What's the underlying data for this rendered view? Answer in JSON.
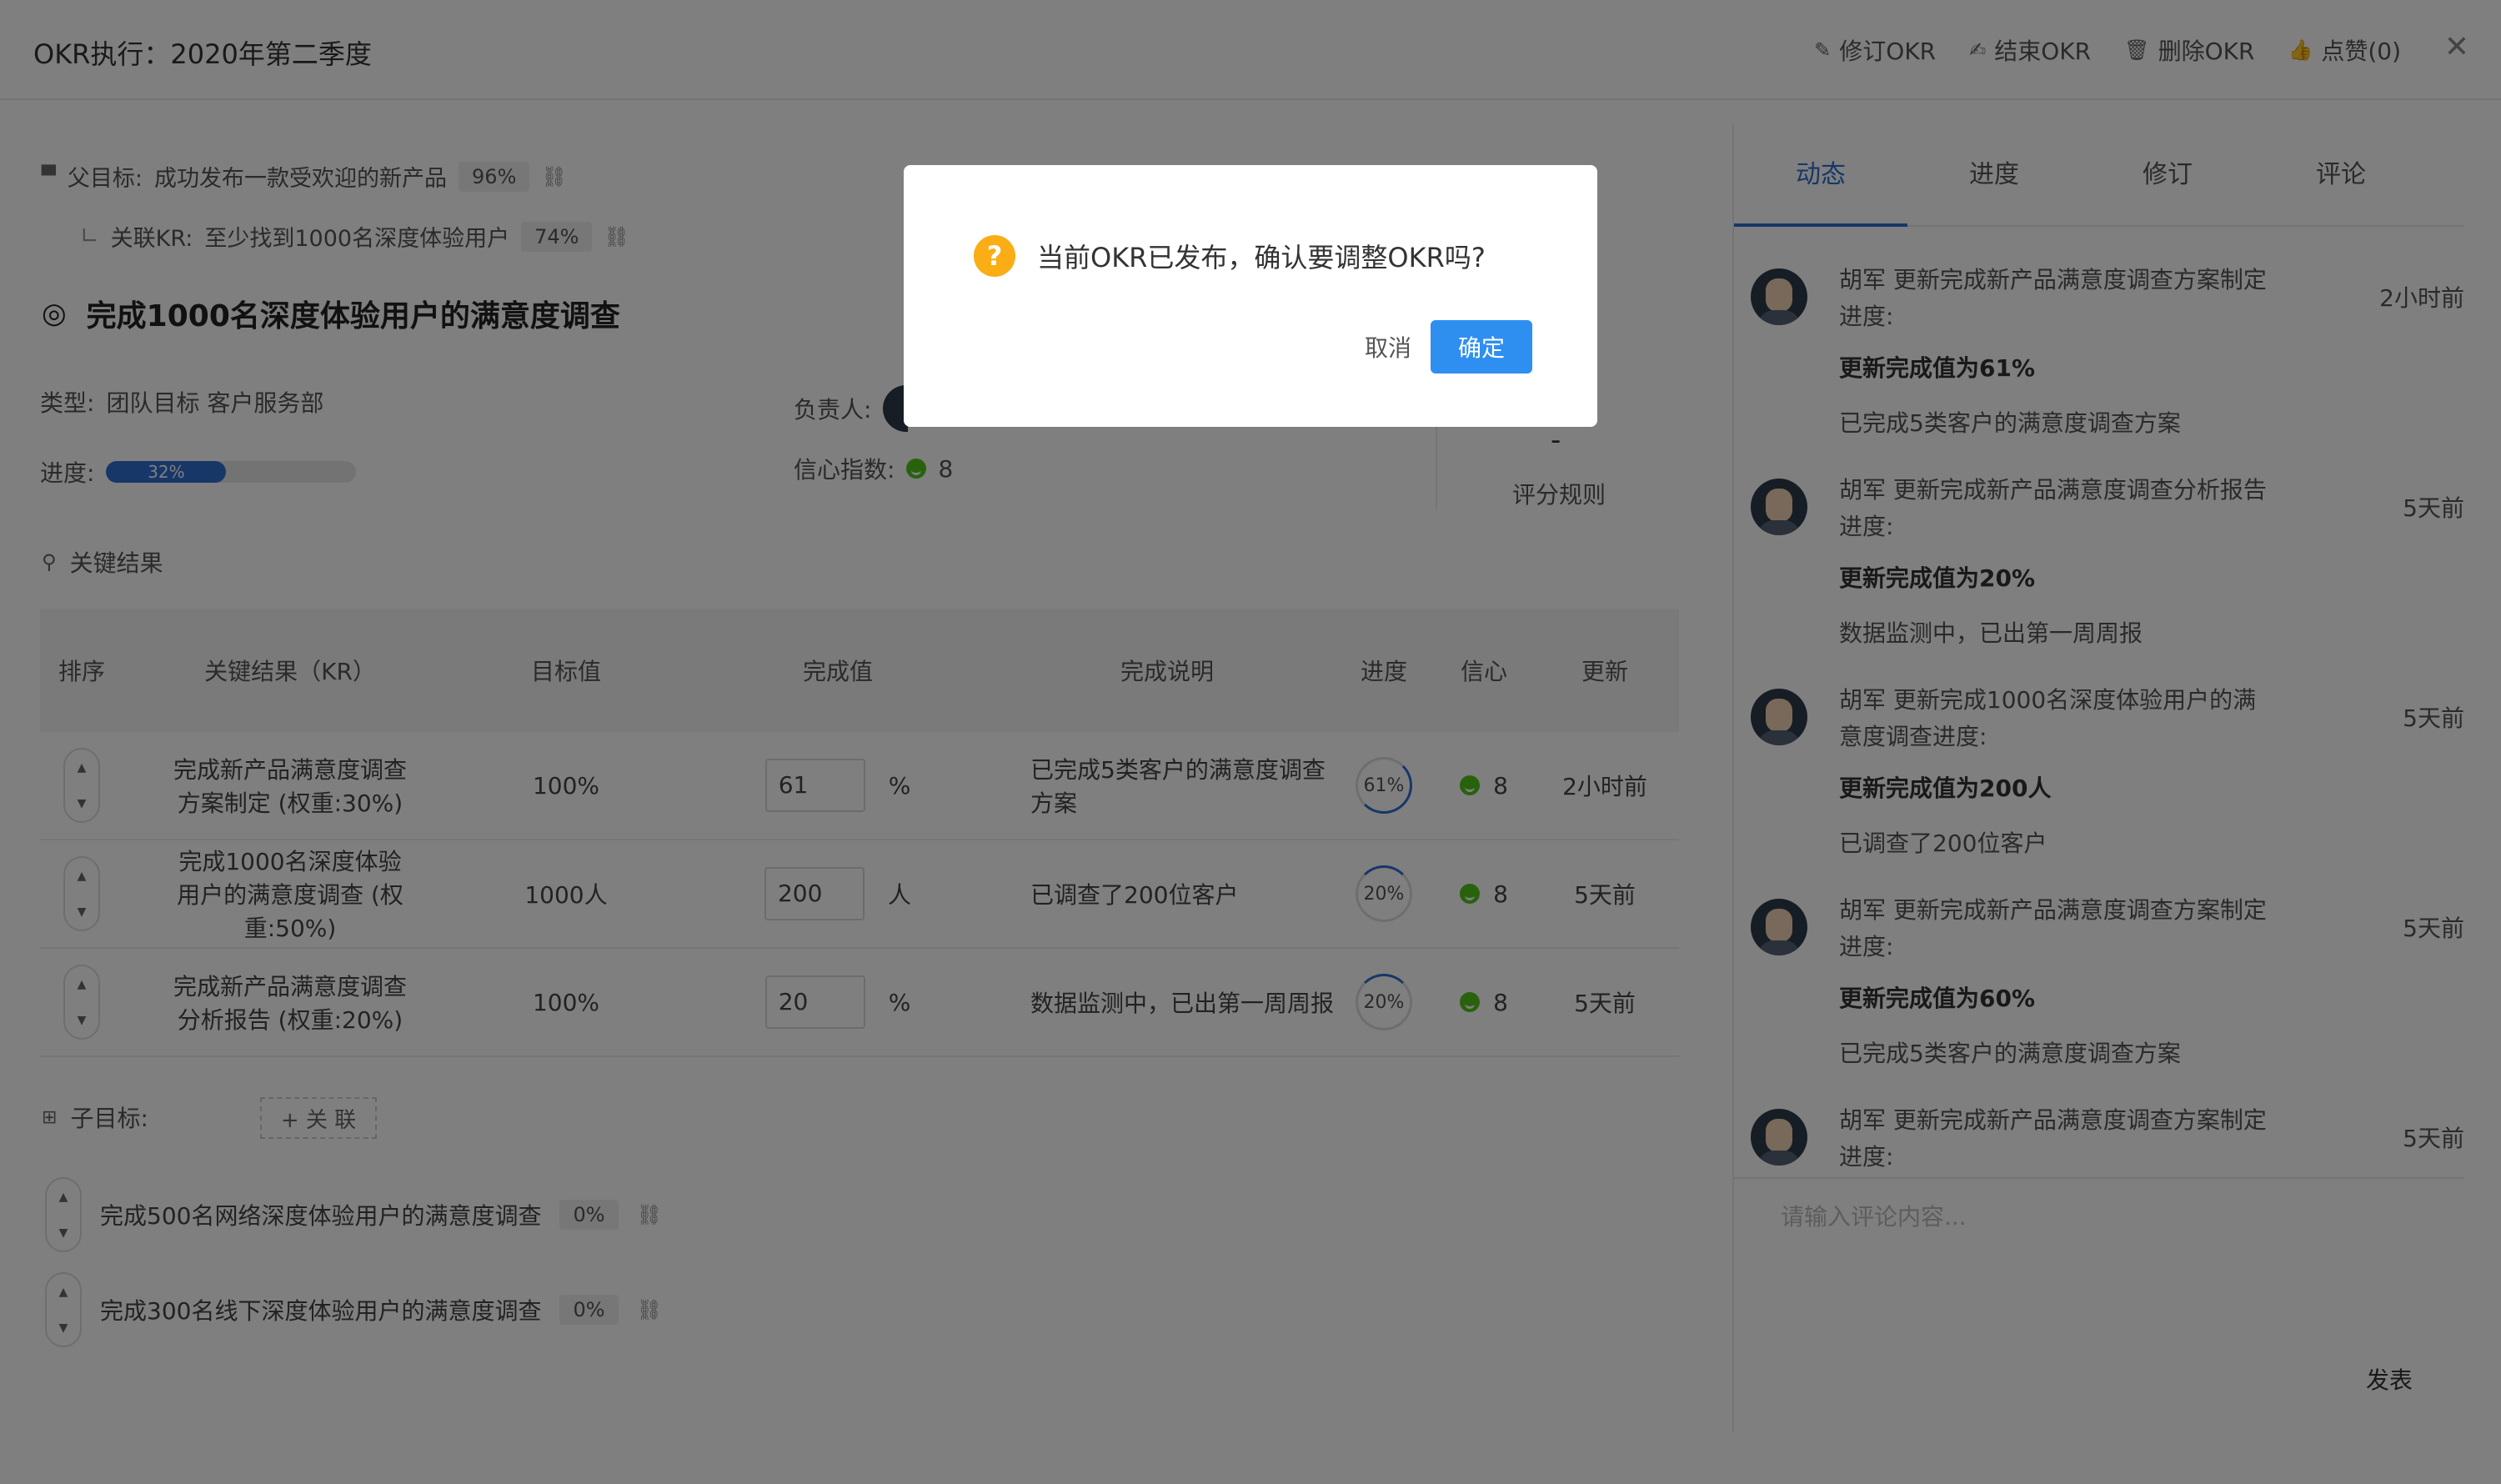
{
  "header": {
    "title": "OKR执行：2020年第二季度",
    "actions": [
      {
        "label": "修订OKR",
        "icon": "edit-icon"
      },
      {
        "label": "结束OKR",
        "icon": "pen-icon"
      },
      {
        "label": "删除OKR",
        "icon": "trash-icon"
      },
      {
        "label": "点赞(0)",
        "icon": "thumbs-up-icon"
      }
    ],
    "close": "✕"
  },
  "parent": {
    "label": "父目标:",
    "text": "成功发布一款受欢迎的新产品",
    "pct": "96%"
  },
  "related_kr": {
    "label": "关联KR:",
    "text": "至少找到1000名深度体验用户",
    "pct": "74%"
  },
  "objective": {
    "title": "完成1000名深度体验用户的满意度调查"
  },
  "meta": {
    "type_label": "类型:",
    "type_value": "团队目标 客户服务部",
    "owner_label": "负责人:",
    "progress_label": "进度:",
    "progress_value": "32%",
    "progress_fraction": 0.32,
    "confidence_label": "信心指数:",
    "confidence_value": "8",
    "score_dash": "-",
    "score_rule": "评分规则"
  },
  "key_results": {
    "section_title": "关键结果",
    "columns": [
      "排序",
      "关键结果（KR）",
      "目标值",
      "完成值",
      "完成说明",
      "进度",
      "信心",
      "更新"
    ],
    "rows": [
      {
        "kr": "完成新产品满意度调查方案制定 (权重:30%)",
        "target": "100%",
        "value": "61",
        "unit": "%",
        "note": "已完成5类客户的满意度调查方案",
        "progress": "61%",
        "confidence": "8",
        "updated": "2小时前"
      },
      {
        "kr": "完成1000名深度体验用户的满意度调查 (权重:50%)",
        "target": "1000人",
        "value": "200",
        "unit": "人",
        "note": "已调查了200位客户",
        "progress": "20%",
        "confidence": "8",
        "updated": "5天前"
      },
      {
        "kr": "完成新产品满意度调查分析报告 (权重:20%)",
        "target": "100%",
        "value": "20",
        "unit": "%",
        "note": "数据监测中，已出第一周周报",
        "progress": "20%",
        "confidence": "8",
        "updated": "5天前"
      }
    ]
  },
  "children": {
    "label": "子目标:",
    "relate_button": "+ 关 联",
    "items": [
      {
        "text": "完成500名网络深度体验用户的满意度调查",
        "pct": "0%"
      },
      {
        "text": "完成300名线下深度体验用户的满意度调查",
        "pct": "0%"
      }
    ]
  },
  "right_panel": {
    "tabs": [
      "动态",
      "进度",
      "修订",
      "评论"
    ],
    "active_tab": 0,
    "feed": [
      {
        "head": "胡军 更新完成新产品满意度调查方案制定进度:",
        "time": "2小时前",
        "value": "更新完成值为61%",
        "note": "已完成5类客户的满意度调查方案"
      },
      {
        "head": "胡军 更新完成新产品满意度调查分析报告进度:",
        "time": "5天前",
        "value": "更新完成值为20%",
        "note": "数据监测中，已出第一周周报"
      },
      {
        "head": "胡军 更新完成1000名深度体验用户的满意度调查进度:",
        "time": "5天前",
        "value": "更新完成值为200人",
        "note": "已调查了200位客户"
      },
      {
        "head": "胡军 更新完成新产品满意度调查方案制定进度:",
        "time": "5天前",
        "value": "更新完成值为60%",
        "note": "已完成5类客户的满意度调查方案"
      },
      {
        "head": "胡军 更新完成新产品满意度调查方案制定进度:",
        "time": "5天前",
        "value": "",
        "note": ""
      }
    ],
    "comment_placeholder": "请输入评论内容...",
    "post_label": "发表"
  },
  "modal": {
    "message": "当前OKR已发布，确认要调整OKR吗?",
    "cancel": "取消",
    "confirm": "确定"
  }
}
